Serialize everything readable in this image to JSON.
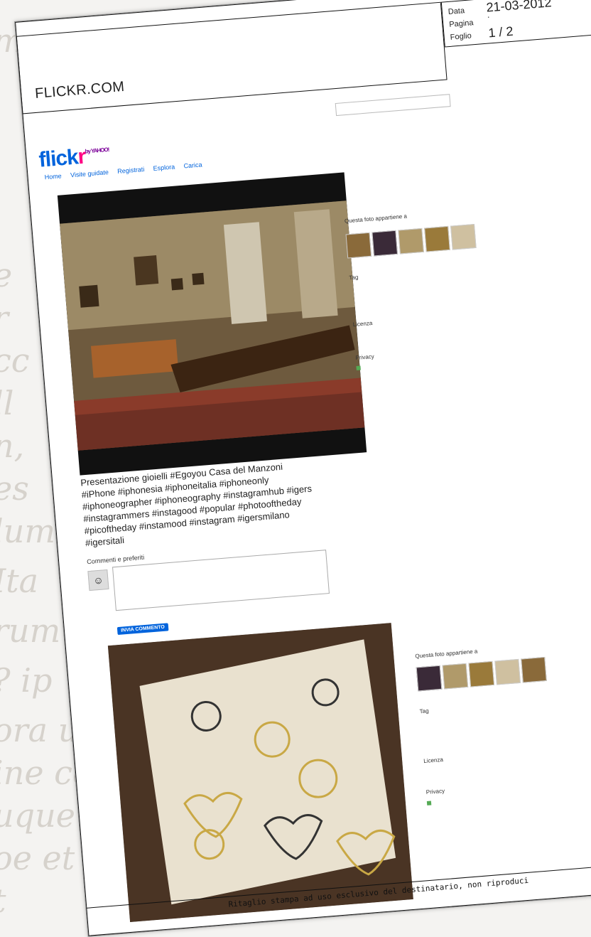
{
  "clipping": {
    "source": "FLICKR.COM",
    "date_label": "Data",
    "date_value": "21-03-2012",
    "page_label": "Pagina",
    "page_value": "·",
    "sheet_label": "Foglio",
    "sheet_value": "1 / 2",
    "footer": "Ritaglio   stampa   ad   uso esclusivo   del   destinatario,   non   riproduci"
  },
  "flickr": {
    "logo": "flickr",
    "yahoo": "by YAHOO!",
    "nav": [
      "Home",
      "Visite guidate",
      "Registrati",
      "Esplora",
      "Carica"
    ],
    "caption": "Presentazione gioielli #Egoyou Casa del Manzoni #iPhone #iphonesia #iphoneitalia #iphoneonly #iphoneographer #iphoneography #instagramhub #igers #instagrammers #instagood #popular #photooftheday #picoftheday #instamood #instagram #igersmilano #igersitali",
    "comments_title": "Commenti e preferiti",
    "send_button": "INVIA COMMENTO",
    "sidebar": {
      "belongs_to": "Questa foto appartiene a",
      "tag": "Tag",
      "license": "Licenza",
      "privacy": "Privacy"
    }
  },
  "colors": {
    "flickr_blue": "#0063dc",
    "flickr_pink": "#ff0084"
  }
}
